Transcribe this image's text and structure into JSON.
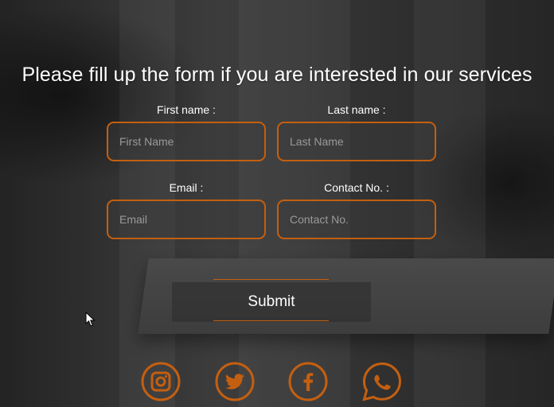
{
  "form": {
    "title": "Please fill up the form if you are interested in our services",
    "first_name": {
      "label": "First name :",
      "placeholder": "First Name"
    },
    "last_name": {
      "label": "Last name :",
      "placeholder": "Last Name"
    },
    "email": {
      "label": "Email :",
      "placeholder": "Email"
    },
    "contact": {
      "label": "Contact No. :",
      "placeholder": "Contact No."
    },
    "submit_label": "Submit"
  },
  "social": [
    {
      "icon": "instagram-icon"
    },
    {
      "icon": "twitter-icon"
    },
    {
      "icon": "facebook-icon"
    },
    {
      "icon": "whatsapp-icon"
    }
  ],
  "colors": {
    "accent": "#c45f10",
    "text": "#ffffff",
    "placeholder": "#9a9a9a"
  }
}
